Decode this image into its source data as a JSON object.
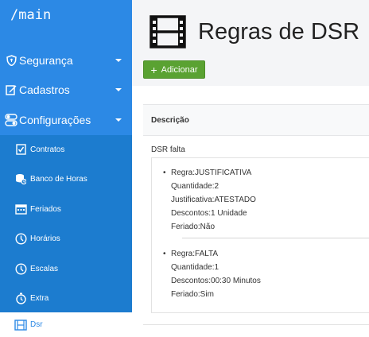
{
  "brand": "/main",
  "nav": {
    "items": [
      {
        "label": "Segurança",
        "icon": "shield-icon"
      },
      {
        "label": "Cadastros",
        "icon": "edit-icon"
      },
      {
        "label": "Configurações",
        "icon": "toggle-icon"
      }
    ],
    "sub_items": [
      {
        "label": "Contratos",
        "icon": "check-document-icon"
      },
      {
        "label": "Banco de Horas",
        "icon": "database-icon"
      },
      {
        "label": "Feriados",
        "icon": "calendar-icon"
      },
      {
        "label": "Horários",
        "icon": "clock-icon"
      },
      {
        "label": "Escalas",
        "icon": "clock-icon"
      },
      {
        "label": "Extra",
        "icon": "stopwatch-icon"
      },
      {
        "label": "Dsr",
        "icon": "film-icon",
        "active": true
      }
    ]
  },
  "page": {
    "title": "Regras de DSR",
    "add_button": "Adicionar",
    "column_header": "Descrição",
    "row_label": "DSR falta",
    "rules": [
      [
        "Regra:JUSTIFICATIVA",
        "Quantidade:2",
        "Justificativa:ATESTADO",
        "Descontos:1 Unidade",
        "Feriado:Não"
      ],
      [
        "Regra:FALTA",
        "Quantidade:1",
        "Descontos:00:30 Minutos",
        "Feriado:Sim"
      ]
    ]
  },
  "colors": {
    "sidebar": "#2c89e5",
    "submenu": "#1c7ccf",
    "add_button": "#5aa232"
  }
}
